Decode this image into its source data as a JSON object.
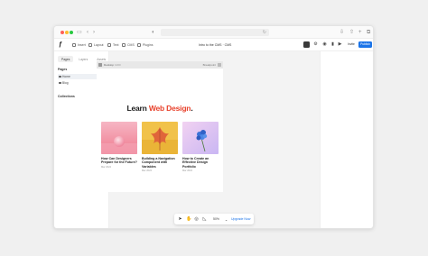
{
  "toolbar": {
    "tools": [
      {
        "label": "Insert",
        "icon": "plus-icon"
      },
      {
        "label": "Layout",
        "icon": "layout-icon"
      },
      {
        "label": "Text",
        "icon": "text-icon"
      },
      {
        "label": "CMS",
        "icon": "database-icon"
      },
      {
        "label": "Plugins",
        "icon": "plugin-icon"
      }
    ],
    "doc_title": "Intro to the CMS · CMS",
    "invite_label": "Invite",
    "publish_label": "Publish"
  },
  "left_panel": {
    "tabs": [
      "Pages",
      "Layers",
      "Assets"
    ],
    "pages_heading": "Pages",
    "pages": [
      {
        "label": "Home",
        "active": true
      },
      {
        "label": "Blog",
        "active": false
      }
    ],
    "cms_heading": "Collections"
  },
  "frame": {
    "name": "Desktop",
    "size": "1200",
    "breakpoint": "Breakpoint",
    "headline_prefix": "Learn ",
    "headline_accent": "Web Design",
    "headline_suffix": ".",
    "cards": [
      {
        "title": "How Can Designers Prepare for the Future?",
        "meta": "Mar 2024",
        "image": "pink-sphere-image"
      },
      {
        "title": "Building a Navigation Component with Variables",
        "meta": "Mar 2024",
        "image": "yellow-leaf-image"
      },
      {
        "title": "How to Create an Effective Design Portfolio",
        "meta": "Mar 2024",
        "image": "blue-flower-image"
      }
    ]
  },
  "bottom_toolbar": {
    "zoom": "50%",
    "upgrade_label": "Upgrade Now"
  },
  "colors": {
    "accent": "#e8422c",
    "publish": "#1a73e8"
  }
}
